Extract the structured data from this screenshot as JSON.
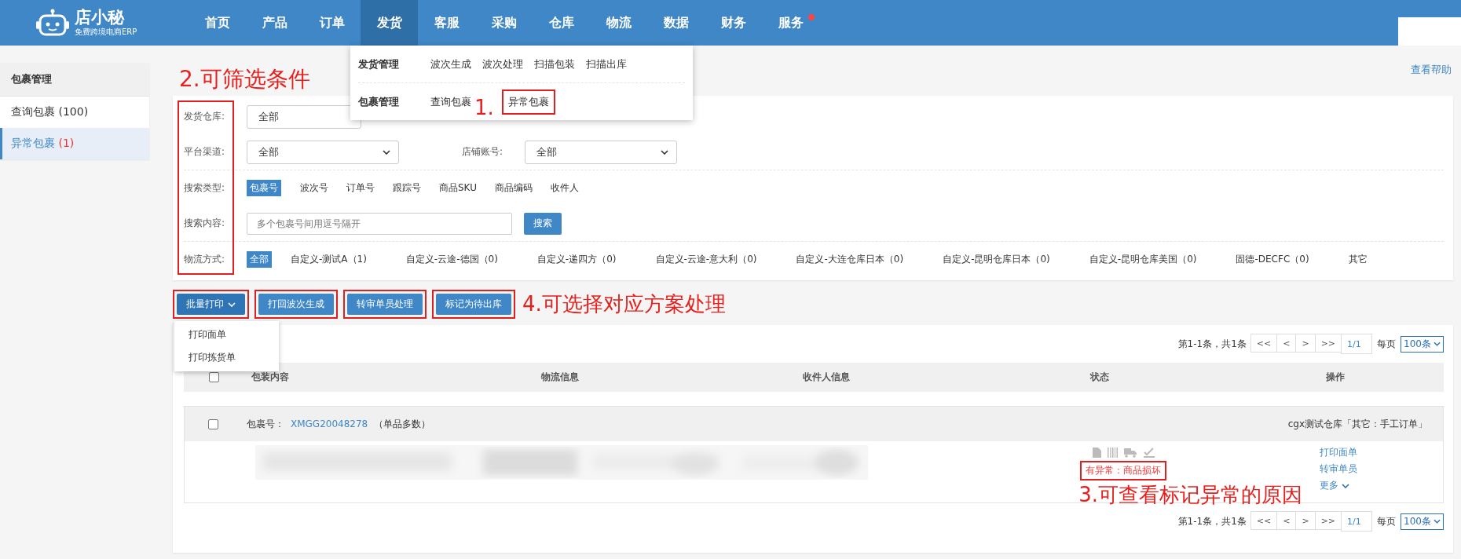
{
  "header": {
    "logo": {
      "name": "店小秘",
      "tagline": "免费跨境电商ERP"
    },
    "nav": [
      {
        "label": "首页",
        "selected": false,
        "notification": false
      },
      {
        "label": "产品",
        "selected": false,
        "notification": false
      },
      {
        "label": "订单",
        "selected": false,
        "notification": false
      },
      {
        "label": "发货",
        "selected": true,
        "notification": false
      },
      {
        "label": "客服",
        "selected": false,
        "notification": false
      },
      {
        "label": "采购",
        "selected": false,
        "notification": false
      },
      {
        "label": "仓库",
        "selected": false,
        "notification": false
      },
      {
        "label": "物流",
        "selected": false,
        "notification": false
      },
      {
        "label": "数据",
        "selected": false,
        "notification": false
      },
      {
        "label": "财务",
        "selected": false,
        "notification": false
      },
      {
        "label": "服务",
        "selected": false,
        "notification": true
      }
    ]
  },
  "nav_menu": {
    "groups": [
      {
        "title": "发货管理",
        "links": [
          {
            "label": "波次生成",
            "framed": false
          },
          {
            "label": "波次处理",
            "framed": false
          },
          {
            "label": "扫描包装",
            "framed": false
          },
          {
            "label": "扫描出库",
            "framed": false
          }
        ]
      },
      {
        "title": "包裹管理",
        "links": [
          {
            "label": "查询包裹",
            "framed": false
          },
          {
            "label": "异常包裹",
            "framed": true
          }
        ]
      }
    ]
  },
  "sidebar": {
    "title": "包裹管理",
    "items": [
      {
        "label": "查询包裹",
        "count": "(100)",
        "count_alert": false,
        "selected": false
      },
      {
        "label": "异常包裹",
        "count": "(1)",
        "count_alert": true,
        "selected": true
      }
    ]
  },
  "help_link": "查看帮助",
  "filters": {
    "warehouse": {
      "label": "发货仓库:",
      "value": "全部"
    },
    "platform": {
      "label": "平台渠道:",
      "value": "全部"
    },
    "shop": {
      "label": "店铺账号:",
      "value": "全部"
    },
    "search_type": {
      "label": "搜索类型:",
      "options": [
        {
          "label": "包裹号",
          "selected": true
        },
        {
          "label": "波次号",
          "selected": false
        },
        {
          "label": "订单号",
          "selected": false
        },
        {
          "label": "跟踪号",
          "selected": false
        },
        {
          "label": "商品SKU",
          "selected": false
        },
        {
          "label": "商品编码",
          "selected": false
        },
        {
          "label": "收件人",
          "selected": false
        }
      ]
    },
    "search_content": {
      "label": "搜索内容:",
      "placeholder": "多个包裹号间用逗号隔开",
      "button": "搜索"
    },
    "shipping": {
      "label": "物流方式:",
      "options": [
        {
          "label": "全部",
          "selected": true
        },
        {
          "label": "自定义-测试A（1)",
          "selected": false
        },
        {
          "label": "自定义-云途-德国（0)",
          "selected": false
        },
        {
          "label": "自定义-递四方（0)",
          "selected": false
        },
        {
          "label": "自定义-云途-意大利（0)",
          "selected": false
        },
        {
          "label": "自定义-大连仓库日本（0)",
          "selected": false
        },
        {
          "label": "自定义-昆明仓库日本（0)",
          "selected": false
        },
        {
          "label": "自定义-昆明仓库美国（0)",
          "selected": false
        },
        {
          "label": "固德-DECFC（0)",
          "selected": false
        },
        {
          "label": "其它",
          "selected": false
        }
      ]
    }
  },
  "actions": [
    {
      "label": "批量打印",
      "dropdown": true,
      "expanded": true,
      "menu": [
        "打印面单",
        "打印拣货单"
      ]
    },
    {
      "label": "打回波次生成"
    },
    {
      "label": "转审单员处理"
    },
    {
      "label": "标记为待出库"
    }
  ],
  "pager_top": {
    "summary": "第1-1条，共1条",
    "buttons": [
      "<<",
      "<",
      ">",
      ">>"
    ],
    "page": "1/1",
    "per_page_label": "每页",
    "per_page": "100条"
  },
  "table": {
    "select_all_checked": false,
    "columns": [
      "包装内容",
      "物流信息",
      "收件人信息",
      "状态",
      "操作"
    ],
    "rows": [
      {
        "checked": false,
        "package_label": "包裹号：",
        "package_id": "XMGG20048278",
        "note": "（单品多数）",
        "warehouse": "cgx测试仓库「其它：手工订单」",
        "content": {
          "kind": "picture"
        },
        "status": "有异常：商品损坏",
        "operations": [
          {
            "label": "打印面单"
          },
          {
            "label": "转审单员"
          },
          {
            "label": "更多",
            "caret": true
          }
        ]
      }
    ]
  },
  "pager_bottom": {
    "summary": "第1-1条，共1条",
    "buttons": [
      "<<",
      "<",
      ">",
      ">>"
    ],
    "page": "1/1",
    "per_page_label": "每页",
    "per_page": "100条"
  },
  "annotations": {
    "menu": "1.",
    "filters": "2.可筛选条件",
    "status": "3.可查看标记异常的原因",
    "actions": "4.可选择对应方案处理"
  }
}
